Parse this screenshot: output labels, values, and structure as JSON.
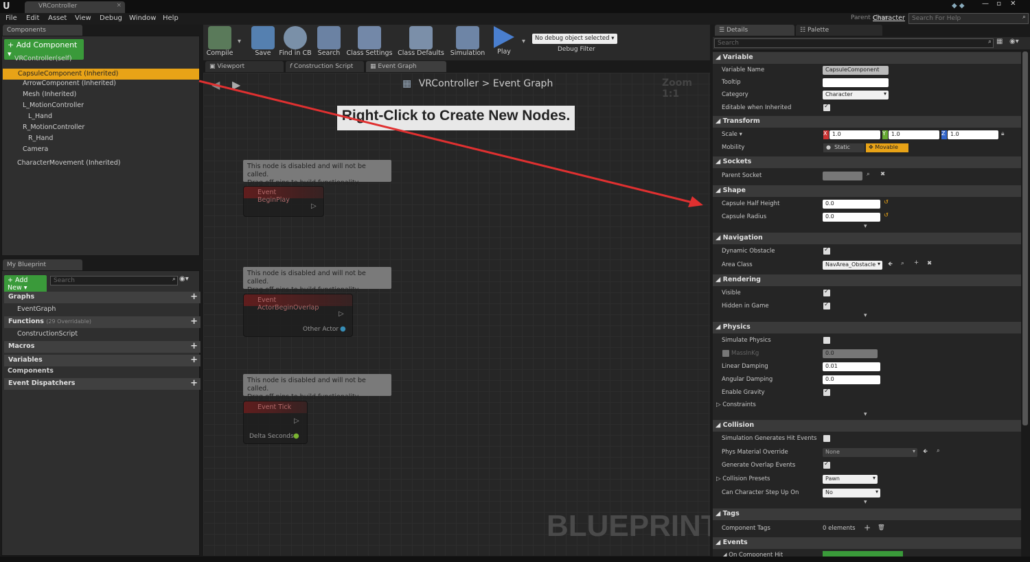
{
  "window": {
    "app_logo": "U",
    "tab_title": "VRController",
    "parent_class_label": "Parent class:",
    "parent_class_value": "Character",
    "help_search_placeholder": "Search For Help"
  },
  "menu": [
    "File",
    "Edit",
    "Asset",
    "View",
    "Debug",
    "Window",
    "Help"
  ],
  "components": {
    "tab": "Components",
    "add_button": "Add Component",
    "self": "VRController(self)",
    "items": [
      "CapsuleComponent (Inherited)",
      "ArrowComponent (Inherited)",
      "Mesh (Inherited)",
      "L_MotionController",
      "L_Hand",
      "R_MotionController",
      "R_Hand",
      "Camera",
      "CharacterMovement (Inherited)"
    ]
  },
  "my_blueprint": {
    "tab": "My Blueprint",
    "add_new": "Add New",
    "search_placeholder": "Search",
    "graphs": "Graphs",
    "event_graph": "EventGraph",
    "functions": "Functions",
    "functions_note": "(29 Overridable)",
    "construction_script": "ConstructionScript",
    "macros": "Macros",
    "variables": "Variables",
    "components": "Components",
    "event_dispatchers": "Event Dispatchers"
  },
  "toolbar": {
    "compile": "Compile",
    "save": "Save",
    "find_in_cb": "Find in CB",
    "search": "Search",
    "class_settings": "Class Settings",
    "class_defaults": "Class Defaults",
    "simulation": "Simulation",
    "play": "Play",
    "debug_object": "No debug object selected",
    "debug_filter": "Debug Filter"
  },
  "graph_tabs": [
    "Viewport",
    "Construction Script",
    "Event Graph"
  ],
  "graph": {
    "breadcrumb_root": "VRController",
    "breadcrumb_sep": ">",
    "breadcrumb_leaf": "Event Graph",
    "zoom": "Zoom 1:1",
    "hint": "Right-Click to Create New Nodes.",
    "watermark": "BLUEPRINT",
    "disabled_line1": "This node is disabled and will not be called.",
    "disabled_line2": "Drag off pins to build functionality.",
    "node1": "Event BeginPlay",
    "node2": "Event ActorBeginOverlap",
    "node2_pin": "Other Actor",
    "node3": "Event Tick",
    "node3_pin": "Delta Seconds"
  },
  "details": {
    "tab_details": "Details",
    "tab_palette": "Palette",
    "search_placeholder": "Search",
    "variable": "Variable",
    "var_name_label": "Variable Name",
    "var_name_value": "CapsuleComponent",
    "tooltip_label": "Tooltip",
    "category_label": "Category",
    "category_value": "Character",
    "editable_label": "Editable when Inherited",
    "transform": "Transform",
    "scale_label": "Scale",
    "scale_x": "1.0",
    "scale_y": "1.0",
    "scale_z": "1.0",
    "mobility_label": "Mobility",
    "static": "Static",
    "movable": "Movable",
    "sockets": "Sockets",
    "parent_socket": "Parent Socket",
    "shape": "Shape",
    "half_height_label": "Capsule Half Height",
    "half_height": "0.0",
    "radius_label": "Capsule Radius",
    "radius": "0.0",
    "navigation": "Navigation",
    "dyn_obstacle": "Dynamic Obstacle",
    "area_class": "Area Class",
    "area_value": "NavArea_Obstacle",
    "rendering": "Rendering",
    "visible": "Visible",
    "hidden_in_game": "Hidden in Game",
    "physics": "Physics",
    "simulate_physics": "Simulate Physics",
    "mass_label": "MassInKg",
    "mass_value": "0.0",
    "linear_damping": "Linear Damping",
    "linear_value": "0.01",
    "angular_damping": "Angular Damping",
    "angular_value": "0.0",
    "enable_gravity": "Enable Gravity",
    "constraints": "Constraints",
    "collision": "Collision",
    "sim_hit": "Simulation Generates Hit Events",
    "phys_mat": "Phys Material Override",
    "phys_mat_value": "None",
    "gen_overlap": "Generate Overlap Events",
    "presets": "Collision Presets",
    "presets_value": "Pawn",
    "step_up": "Can Character Step Up On",
    "step_up_value": "No",
    "tags": "Tags",
    "component_tags": "Component Tags",
    "elements": "0 elements",
    "events": "Events",
    "on_hit": "On Component Hit"
  },
  "colors": {
    "accent_green": "#3a9a3a",
    "selection": "#e8a317",
    "arrow": "#e03030"
  }
}
